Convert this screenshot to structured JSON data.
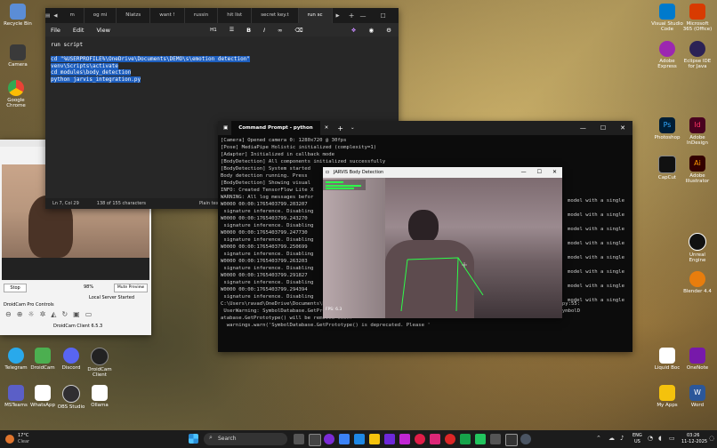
{
  "desktop": {
    "icons": [
      {
        "label": "Recycle Bin",
        "color": "#5b8dd6"
      },
      {
        "label": "Camera",
        "color": "#3a3a3a"
      },
      {
        "label": "Google Chrome",
        "color": "#e94235"
      },
      {
        "label": "Telegram",
        "color": "#29a9eb"
      },
      {
        "label": "DroidCam",
        "color": "#4caf50"
      },
      {
        "label": "Discord",
        "color": "#5865f2"
      },
      {
        "label": "DroidCam Client",
        "color": "#222222"
      },
      {
        "label": "MSTeams",
        "color": "#5b5fc7"
      },
      {
        "label": "WhatsApp",
        "color": "#ffffff"
      },
      {
        "label": "OBS Studio",
        "color": "#302e31"
      },
      {
        "label": "Ollama",
        "color": "#ffffff"
      },
      {
        "label": "Visual Studio Code",
        "color": "#007acc"
      },
      {
        "label": "Microsoft 365 (Office)",
        "color": "#d83b01"
      },
      {
        "label": "Adobe Express",
        "color": "#9c27b0"
      },
      {
        "label": "Eclipse IDE for Java",
        "color": "#2c2255"
      },
      {
        "label": "Photoshop",
        "color": "#001e36"
      },
      {
        "label": "Adobe InDesign",
        "color": "#49021f"
      },
      {
        "label": "CapCut",
        "color": "#111111"
      },
      {
        "label": "Adobe Illustrator",
        "color": "#330000"
      },
      {
        "label": "Unreal Engine",
        "color": "#111111"
      },
      {
        "label": "Blender 4.4",
        "color": "#e87d0d"
      },
      {
        "label": "Liquid Boc",
        "color": "#ffffff"
      },
      {
        "label": "OneNote",
        "color": "#7719aa"
      },
      {
        "label": "My Apps",
        "color": "#f4c20d"
      },
      {
        "label": "Word",
        "color": "#2b579a"
      }
    ]
  },
  "notepad": {
    "tabs": [
      "m",
      "og mi",
      "Nlatzs",
      "want !",
      "russin",
      "hit list",
      "secret key.t",
      "run sc"
    ],
    "menu": [
      "File",
      "Edit",
      "View"
    ],
    "heading_dropdown": "H1",
    "content": {
      "line1": "run script",
      "line2": "cd \"%USERPROFILE%\\OneDrive\\Documents\\DEMO\\s\\emotion detection\"",
      "line3": "venv\\Scripts\\activate",
      "line4": "cd modules\\body_detection",
      "line5": "python jarvis_integration.py"
    },
    "status": {
      "position": "Ln 7, Col 29",
      "chars": "138 of 155 characters",
      "format": "Plain text"
    }
  },
  "cmd": {
    "title": "Command Prompt - python",
    "lines": [
      "[Camera] Opened camera 0: 1280x720 @ 30fps",
      "[Pose] MediaPipe Holistic initialized (complexity=1)",
      "[Adapter] Initialized in callback mode",
      "[BodyDetection] All components initialized successfully",
      "[BodyDetection] System started",
      "Body detection running. Press",
      "[BodyDetection] Showing visual",
      "INFO: Created TensorFlow Lite X",
      "WARNING: All log messages befor",
      "W0000 00:00:1765403799.203207",
      " signature inference. Disabling",
      "W0000 00:00:1765403799.243270",
      " signature inference. Disabling",
      "W0000 00:00:1765403799.247730",
      " signature inference. Disabling",
      "W0000 00:00:1765403799.250699",
      " signature inference. Disabling",
      "W0000 00:00:1765403799.263203",
      " signature inference. Disabling",
      "W0000 00:00:1765403799.291827",
      " signature inference. Disabling",
      "W0000 00:00:1765403799.294394",
      " signature inference. Disabling",
      "C:\\Users\\ravad\\OneDrive\\Documents\\DEMO\\s\\emotion detection\\venv\\Lib\\site-packages\\google\\protobuf\\symbol_database.py:55:",
      " UserWarning: SymbolDatabase.GetPrototype() is deprecated. Please use message_factory.GetMessageClass() instead. SymbolD",
      "atabase.GetPrototype() will be removed soon.",
      "  warnings.warn('SymbolDatabase.GetPrototype() is deprecated. Please '"
    ],
    "right_fragments": [
      "model with a single",
      "model with a single",
      "model with a single",
      "model with a single",
      "model with a single",
      "model with a single",
      "model with a single",
      "model with a single"
    ]
  },
  "camera_window": {
    "title": "JARVIS Body Detection",
    "fps": "FPS: 6.3"
  },
  "droidcam": {
    "stop_label": "Stop",
    "battery": "98%",
    "mute_label": "Mute Preview",
    "server_status": "Local Server Started",
    "pro_controls": "DroidCam Pro Controls",
    "version": "DroidCam Client 6.5.3"
  },
  "taskbar": {
    "weather_temp": "17°C",
    "weather_text": "Clear",
    "search_placeholder": "Search",
    "lang": "ENG",
    "region": "US",
    "time": "03:26",
    "date": "11-12-2025"
  }
}
